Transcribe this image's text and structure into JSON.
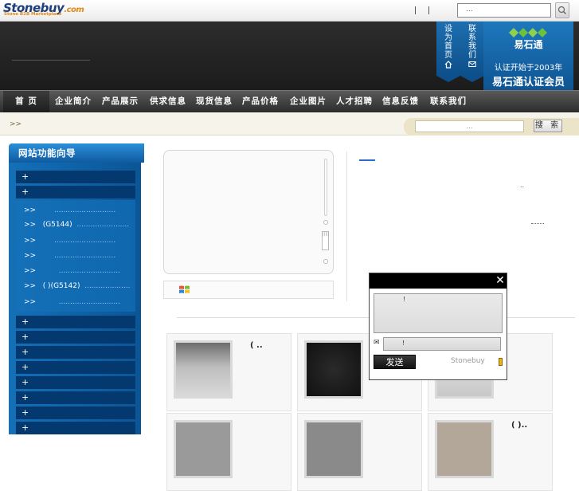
{
  "topbar": {
    "logo_text": "Stonebuy",
    "logo_com": ".com",
    "logo_tagline": "Stone B2B Marketplace",
    "search_placeholder": "..."
  },
  "header": {
    "ribbons": [
      {
        "label_lines": [
          "设",
          "为",
          "首",
          "页"
        ],
        "icon": "home-icon"
      },
      {
        "label_lines": [
          "联",
          "系",
          "我",
          "们"
        ],
        "icon": "mail-icon"
      }
    ],
    "badge": {
      "logo_text": "易石通",
      "line1": "认证开始于2003年",
      "line2": "易石通认证会员"
    }
  },
  "nav": {
    "items": [
      "首 页",
      "企业简介",
      "产品展示",
      "供求信息",
      "现货信息",
      "产品价格",
      "企业图片",
      "人才招聘",
      "信息反馈",
      "联系我们"
    ]
  },
  "subbar": {
    "breadcrumb": ">>",
    "search_placeholder": "...",
    "search_button": "搜 索"
  },
  "sidebar": {
    "title": "网站功能向导",
    "top_categories": [
      "+",
      "+"
    ],
    "subitems": [
      {
        "arrow": ">>",
        "text": "",
        "dots": "..........................."
      },
      {
        "arrow": ">>",
        "text": "(G5144)",
        "dots": "......................."
      },
      {
        "arrow": ">>",
        "text": "",
        "dots": "..........................."
      },
      {
        "arrow": ">>",
        "text": "",
        "dots": "..........................."
      },
      {
        "arrow": ">>",
        "text": "",
        "dots": "..........................."
      },
      {
        "arrow": ">>",
        "text": "( )(G5142)",
        "dots": "...................."
      },
      {
        "arrow": ">>",
        "text": "",
        "dots": "..........................."
      }
    ],
    "bottom_categories": [
      "+",
      "+",
      "+",
      "+",
      "+",
      "+",
      "+",
      "+"
    ]
  },
  "main": {
    "dots_a": "..",
    "card1_title": "(    ..",
    "card6_title": "(  )..",
    "player_volume_label": "|||||"
  },
  "popup": {
    "text_value": "!",
    "email_value": "!",
    "send_label": "发送",
    "brand": "Stonebuy",
    "close_glyph": "✕",
    "mail_glyph": "✉"
  },
  "colors": {
    "nav_bg": "#3a3a3a",
    "sidebar_blue": "#1470b8",
    "sidebar_dark": "#04396f",
    "badge_blue": "#1e78bd"
  }
}
